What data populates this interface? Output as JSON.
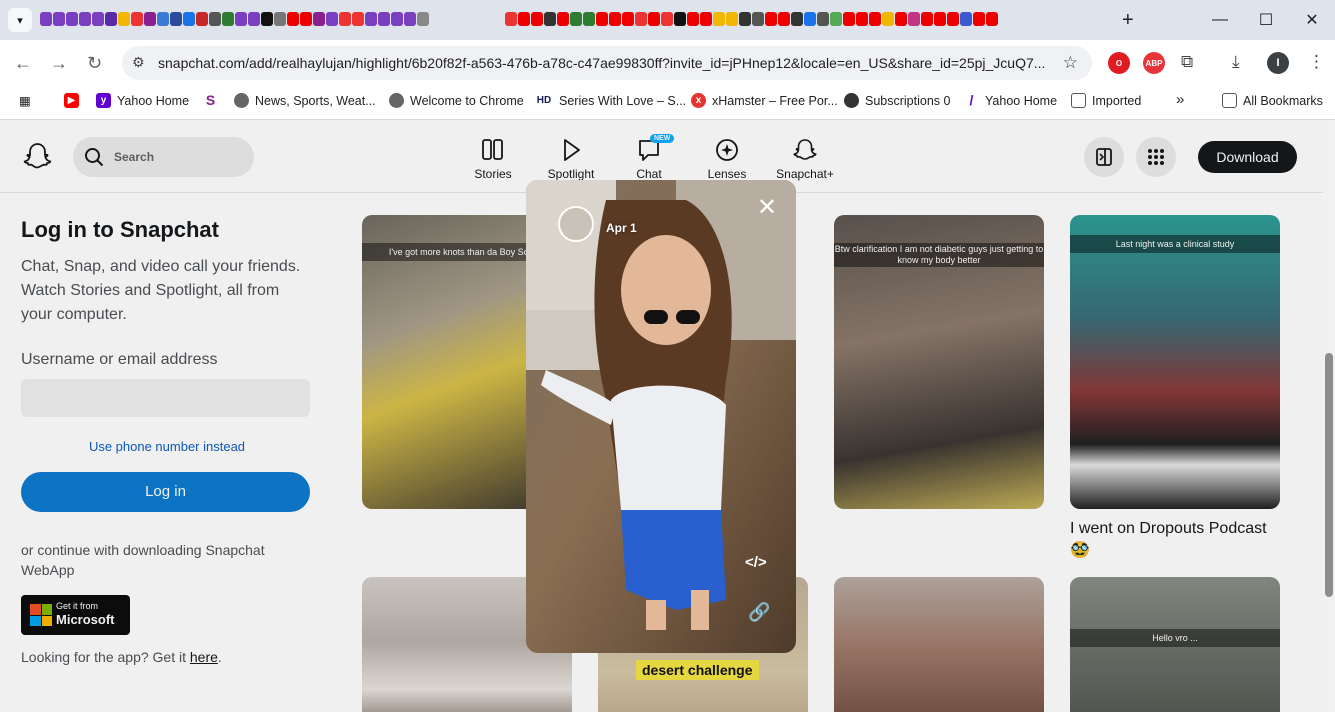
{
  "browser": {
    "url": "snapchat.com/add/realhaylujan/highlight/6b20f82f-a563-476b-a78c-c47ae99830ff?invite_id=jPHnep12&locale=en_US&share_id=25pj_JcuQ7...",
    "bookmarks": [
      {
        "label": "Yahoo Home",
        "icon": "yahoo-icon",
        "color": "#6001d2"
      },
      {
        "label": "News, Sports, Weat...",
        "icon": "globe-icon",
        "color": "#555555"
      },
      {
        "label": "Welcome to Chrome",
        "icon": "globe-icon",
        "color": "#555555"
      },
      {
        "label": "Series With Love – S...",
        "icon": "hd-icon",
        "color": "#1a1a5a"
      },
      {
        "label": "xHamster – Free Por...",
        "icon": "xhamster-icon",
        "color": "#e3342f"
      },
      {
        "label": "Subscriptions 0",
        "icon": "panda-icon",
        "color": "#333333"
      },
      {
        "label": "Yahoo Home",
        "icon": "yahoo-icon",
        "color": "#6001d2"
      },
      {
        "label": "Imported",
        "icon": "folder-icon",
        "color": "#555555"
      }
    ],
    "bookmarks_chevron": "»",
    "all_bookmarks": "All Bookmarks",
    "profile_initial": "I",
    "extension_labels": {
      "abp": "ABP"
    }
  },
  "snap": {
    "search_placeholder": "Search",
    "nav": [
      {
        "label": "Stories"
      },
      {
        "label": "Spotlight"
      },
      {
        "label": "Chat"
      },
      {
        "label": "Lenses"
      },
      {
        "label": "Snapchat+"
      }
    ],
    "new_badge": "NEW",
    "download": "Download",
    "login": {
      "title": "Log in to Snapchat",
      "description": "Chat, Snap, and video call your friends. Watch Stories and Spotlight, all from your computer.",
      "username_label": "Username or email address",
      "phone_link": "Use phone number instead",
      "login_button": "Log in",
      "continue_text": "or continue with downloading Snapchat WebApp",
      "ms_get": "Get it from",
      "ms_name": "Microsoft",
      "app_prefix": "Looking for the app? Get it ",
      "app_link": "here",
      "app_suffix": "."
    },
    "thumbs": [
      {
        "caption": "I've got more knots than da Boy Scouts"
      },
      {
        "caption": "Btw clarification I am not diabetic guys just getting to know my body better"
      },
      {
        "caption": "Last night was a clinical study"
      },
      {
        "caption": "Hello vro ..."
      }
    ],
    "thumb_overlay": "desert challenge",
    "post_caption": "I went on Dropouts Podcast 🥸",
    "viewer": {
      "date": "Apr 1"
    }
  },
  "colors": {
    "accent": "#0e7cd0",
    "link": "#0e5ec2",
    "dark": "#16191c"
  }
}
